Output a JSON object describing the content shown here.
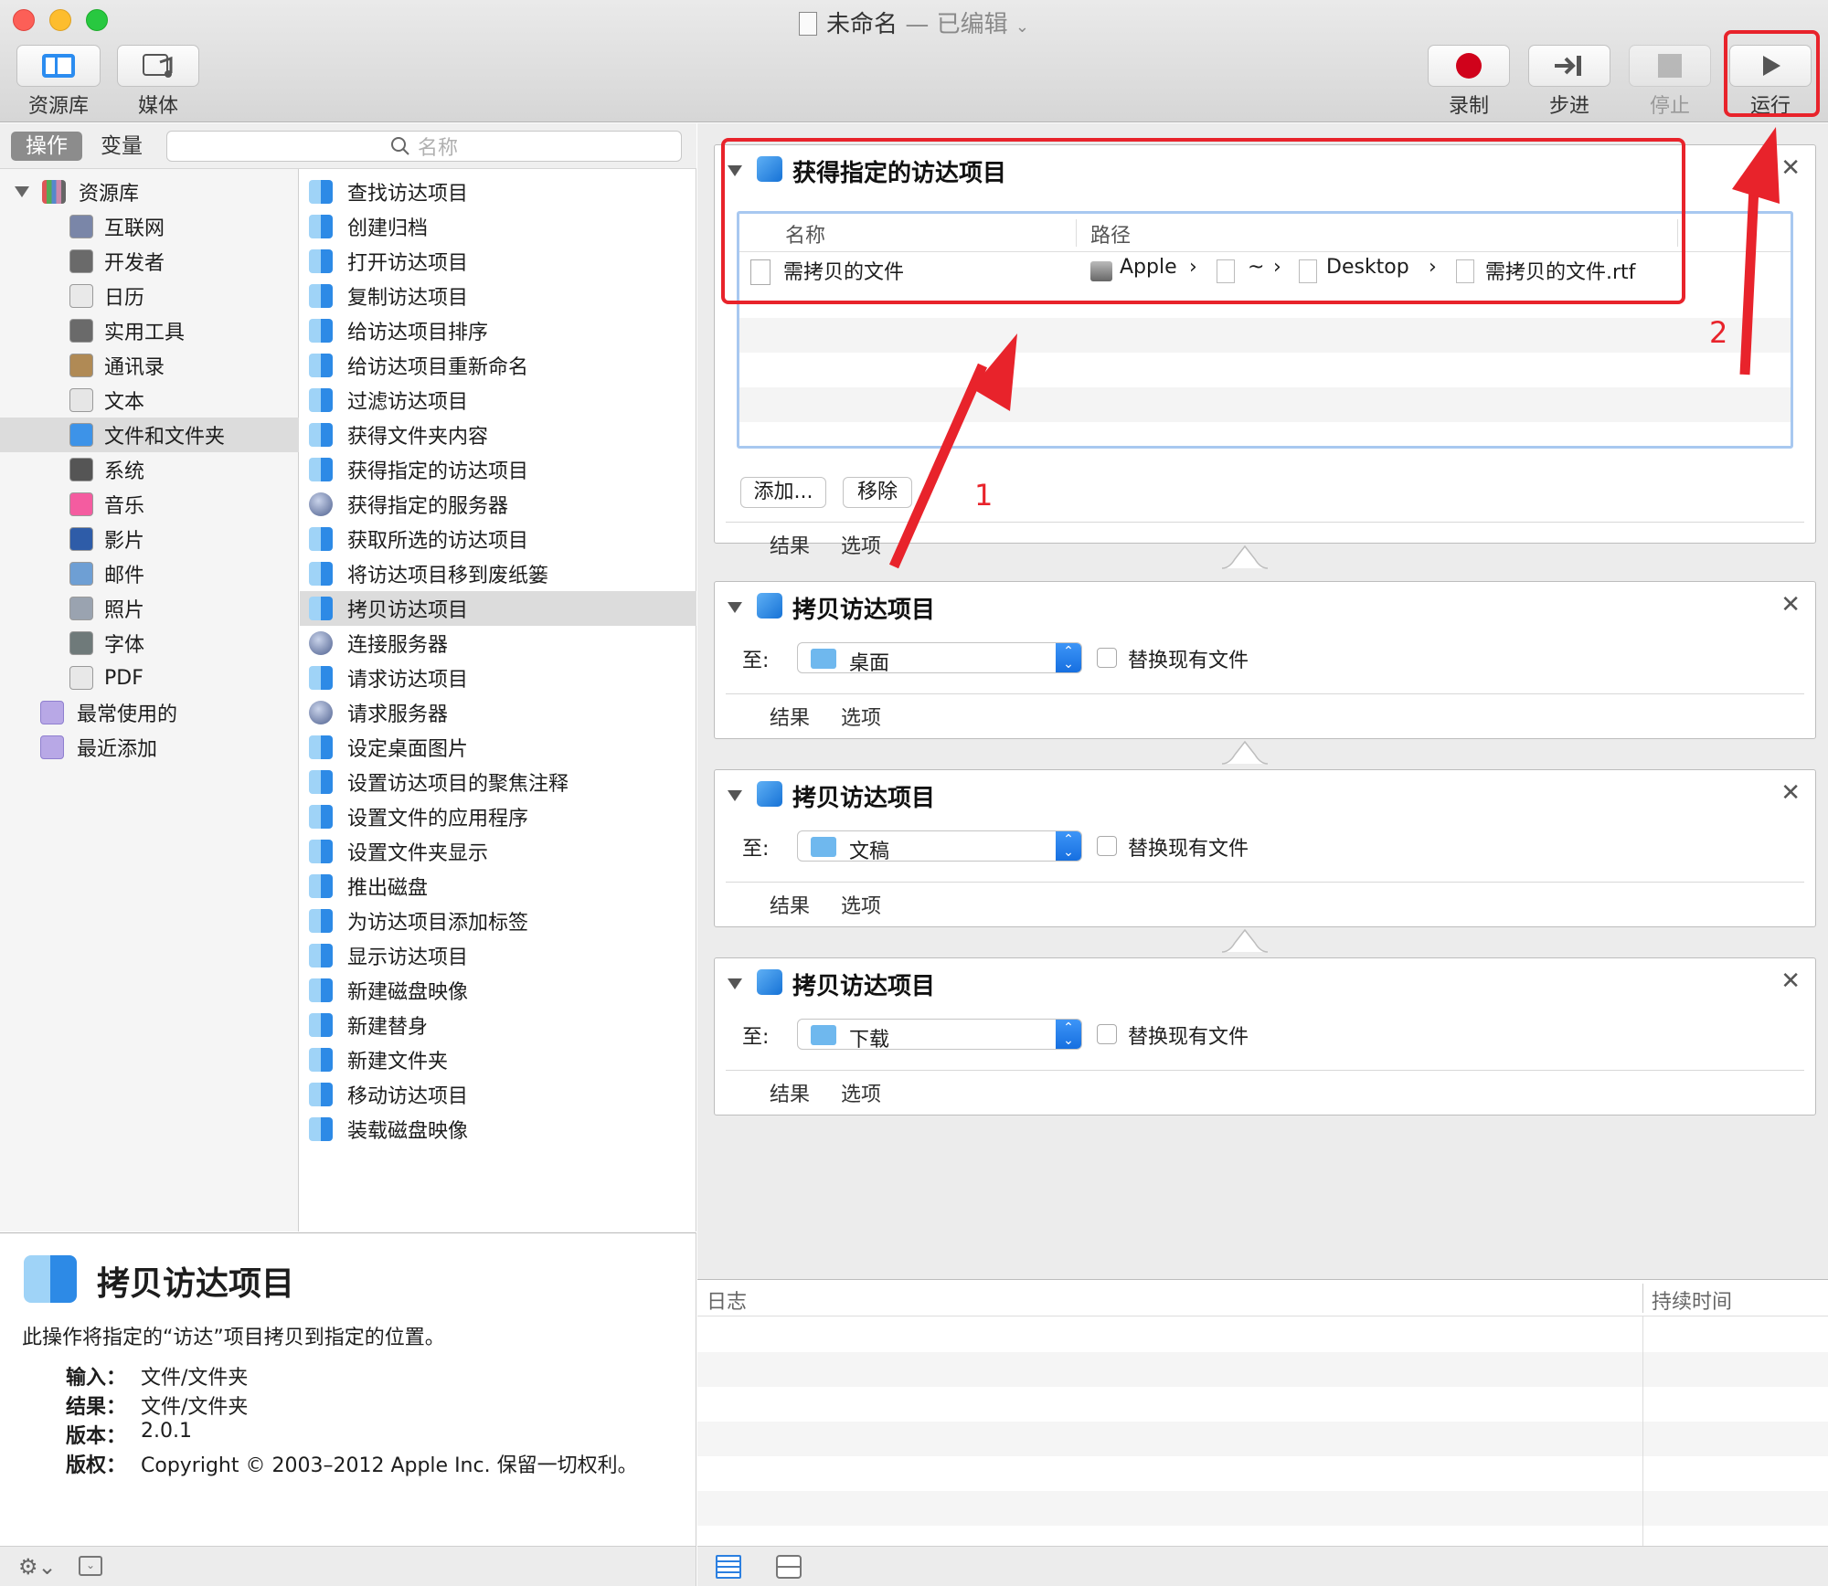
{
  "window": {
    "title": "未命名",
    "title_status": "— 已编辑",
    "title_chevron": "⌄"
  },
  "toolbar": {
    "library_label": "资源库",
    "media_label": "媒体",
    "record_label": "录制",
    "step_label": "步进",
    "stop_label": "停止",
    "run_label": "运行"
  },
  "scope": {
    "actions_tab": "操作",
    "variables_tab": "变量",
    "search_placeholder": "名称"
  },
  "library": {
    "root": "资源库",
    "items": [
      {
        "label": "互联网",
        "icon": "globe-icon",
        "color": "#7a86a8"
      },
      {
        "label": "开发者",
        "icon": "tools-icon",
        "color": "#6a6a6a"
      },
      {
        "label": "日历",
        "icon": "calendar-icon",
        "color": "#e9e9e9"
      },
      {
        "label": "实用工具",
        "icon": "tools-icon",
        "color": "#6a6a6a"
      },
      {
        "label": "通讯录",
        "icon": "contacts-icon",
        "color": "#b08a55"
      },
      {
        "label": "文本",
        "icon": "text-icon",
        "color": "#e6e6e6"
      },
      {
        "label": "文件和文件夹",
        "icon": "finder-icon",
        "color": "#3d93e8"
      },
      {
        "label": "系统",
        "icon": "system-icon",
        "color": "#555555"
      },
      {
        "label": "音乐",
        "icon": "music-icon",
        "color": "#f45ca0"
      },
      {
        "label": "影片",
        "icon": "movie-icon",
        "color": "#2e5ca8"
      },
      {
        "label": "邮件",
        "icon": "mail-icon",
        "color": "#6e9fd4"
      },
      {
        "label": "照片",
        "icon": "photo-icon",
        "color": "#9aa3b0"
      },
      {
        "label": "字体",
        "icon": "font-icon",
        "color": "#6f7a7a"
      },
      {
        "label": "PDF",
        "icon": "pdf-icon",
        "color": "#e8e8e8"
      }
    ],
    "smart": [
      {
        "label": "最常使用的",
        "icon": "smart-folder-icon"
      },
      {
        "label": "最近添加",
        "icon": "smart-folder-icon"
      }
    ],
    "selected_index": 6
  },
  "actions": {
    "items": [
      "查找访达项目",
      "创建归档",
      "打开访达项目",
      "复制访达项目",
      "给访达项目排序",
      "给访达项目重新命名",
      "过滤访达项目",
      "获得文件夹内容",
      "获得指定的访达项目",
      "获得指定的服务器",
      "获取所选的访达项目",
      "将访达项目移到废纸篓",
      "拷贝访达项目",
      "连接服务器",
      "请求访达项目",
      "请求服务器",
      "设定桌面图片",
      "设置访达项目的聚焦注释",
      "设置文件的应用程序",
      "设置文件夹显示",
      "推出磁盘",
      "为访达项目添加标签",
      "显示访达项目",
      "新建磁盘映像",
      "新建替身",
      "新建文件夹",
      "移动访达项目",
      "装载磁盘映像"
    ],
    "globe_indices": [
      9,
      13,
      15
    ],
    "selected_index": 12
  },
  "description": {
    "title": "拷贝访达项目",
    "text": "此操作将指定的“访达”项目拷贝到指定的位置。",
    "fields": [
      {
        "k": "输入：",
        "v": "文件/文件夹"
      },
      {
        "k": "结果：",
        "v": "文件/文件夹"
      },
      {
        "k": "版本：",
        "v": "2.0.1"
      },
      {
        "k": "版权：",
        "v": "Copyright © 2003–2012 Apple Inc. 保留一切权利。"
      }
    ]
  },
  "workflow": {
    "get_items": {
      "title": "获得指定的访达项目",
      "col_name": "名称",
      "col_path": "路径",
      "row_name": "需拷贝的文件",
      "path": [
        "Apple",
        "~",
        "Desktop",
        "需拷贝的文件.rtf"
      ],
      "add_button": "添加...",
      "remove_button": "移除"
    },
    "tab_results": "结果",
    "tab_options": "选项",
    "copy_actions": [
      {
        "title": "拷贝访达项目",
        "to_label": "至:",
        "destination": "桌面",
        "replace_label": "替换现有文件"
      },
      {
        "title": "拷贝访达项目",
        "to_label": "至:",
        "destination": "文稿",
        "replace_label": "替换现有文件"
      },
      {
        "title": "拷贝访达项目",
        "to_label": "至:",
        "destination": "下载",
        "replace_label": "替换现有文件"
      }
    ]
  },
  "annotations": {
    "one": "1",
    "two": "2"
  },
  "log": {
    "col_log": "日志",
    "col_duration": "持续时间"
  },
  "colors": {
    "annotation_red": "#e8232b",
    "accent_blue": "#1672d6"
  }
}
